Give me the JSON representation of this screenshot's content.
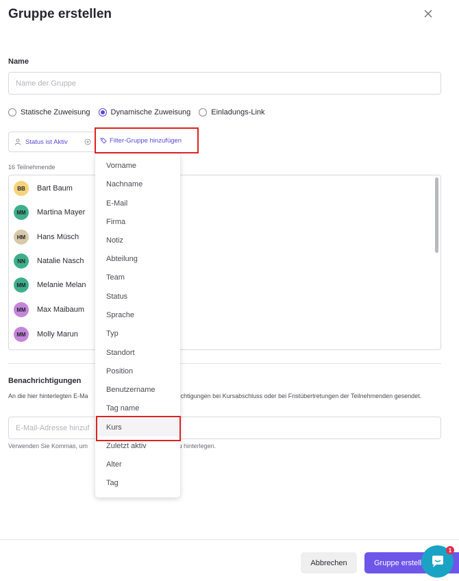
{
  "dialog": {
    "title": "Gruppe erstellen",
    "close_icon": "close-icon"
  },
  "name_section": {
    "label": "Name",
    "placeholder": "Name der Gruppe",
    "value": ""
  },
  "assignment": {
    "options": [
      {
        "label": "Statische Zuweisung",
        "selected": false
      },
      {
        "label": "Dynamische Zuweisung",
        "selected": true
      },
      {
        "label": "Einladungs-Link",
        "selected": false
      }
    ]
  },
  "filters": {
    "active_filter": "Status ist Aktiv",
    "add_filter_label": "Filter-Gruppe hinzufügen"
  },
  "participants": {
    "count_label": "16 Teilnehmende",
    "items": [
      {
        "initials": "BB",
        "name": "Bart Baum",
        "color": "#f5d37a"
      },
      {
        "initials": "MM",
        "name": "Martina Mayer",
        "color": "#3fae8a"
      },
      {
        "initials": "HM",
        "name": "Hans Müsch",
        "color": "#d8c9a8"
      },
      {
        "initials": "NN",
        "name": "Natalie Nasch",
        "color": "#3fae8a"
      },
      {
        "initials": "MM",
        "name": "Melanie Melan",
        "color": "#3fae8a"
      },
      {
        "initials": "MM",
        "name": "Max Maibaum",
        "color": "#c486d9"
      },
      {
        "initials": "MM",
        "name": "Molly Marun",
        "color": "#c486d9"
      }
    ]
  },
  "notifications": {
    "title": "Benachrichtigungen",
    "description_start": "An die hier hinterlegten E-Ma",
    "description_end": "richtigungen bei Kursabschluss oder bei Fristübertretungen der Teilnehmenden gesendet.",
    "email_placeholder": "E-Mail-Adresse hinzuf",
    "hint_start": "Verwenden Sie Kommas, um",
    "hint_end": "zu hinterlegen."
  },
  "dropdown": {
    "items": [
      "Vorname",
      "Nachname",
      "E-Mail",
      "Firma",
      "Notiz",
      "Abteilung",
      "Team",
      "Status",
      "Sprache",
      "Typ",
      "Standort",
      "Position",
      "Benutzername",
      "Tag name",
      "Kurs",
      "Zuletzt aktiv",
      "Alter",
      "Tag"
    ],
    "hovered": "Kurs"
  },
  "footer": {
    "cancel_label": "Abbrechen",
    "create_label": "Gruppe erstellen"
  },
  "chat": {
    "badge": "1"
  },
  "colors": {
    "accent": "#6e56e8",
    "highlight": "#e0201f",
    "chat": "#1aa3c4"
  }
}
